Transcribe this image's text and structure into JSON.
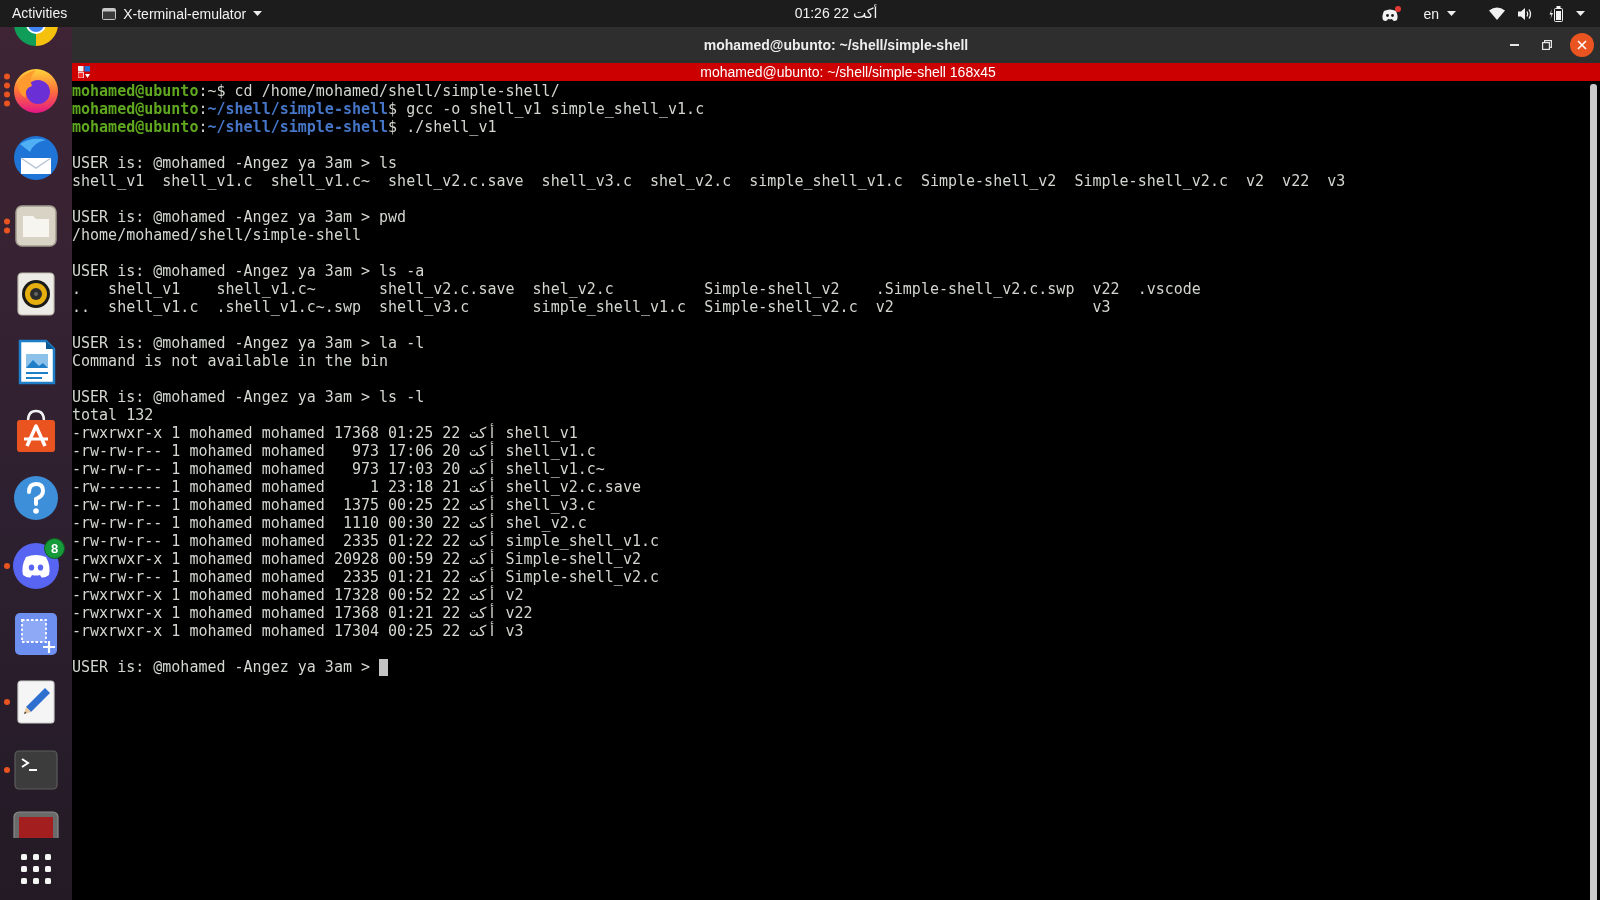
{
  "top_bar": {
    "activities": "Activities",
    "app_menu": "X-terminal-emulator",
    "clock": "01:26  22 أكت",
    "keyboard_layout": "en"
  },
  "dock": {
    "items": [
      {
        "kind": "wheel"
      },
      {
        "kind": "fox",
        "indicators": [
          {
            "kind": "dot"
          },
          {
            "kind": "dot"
          },
          {
            "kind": "dot"
          },
          {
            "kind": "dot"
          }
        ]
      },
      {
        "kind": "mail"
      },
      {
        "kind": "folder",
        "indicators": [
          {
            "kind": "dot"
          },
          {
            "kind": "dot"
          }
        ]
      },
      {
        "kind": "speaker"
      },
      {
        "kind": "document"
      },
      {
        "kind": "store"
      },
      {
        "kind": "help"
      },
      {
        "kind": "chat",
        "indicators": [
          {
            "kind": "dot"
          }
        ],
        "badge": "8"
      },
      {
        "kind": "selection"
      },
      {
        "kind": "pencil",
        "indicators": [
          {
            "kind": "dot"
          }
        ]
      },
      {
        "kind": "terminal",
        "indicators": [
          {
            "kind": "dot"
          }
        ]
      },
      {
        "kind": "tile"
      }
    ]
  },
  "window": {
    "title": "mohamed@ubunto: ~/shell/simple-shell"
  },
  "terminal_title_bar": {
    "title": "mohamed@ubunto: ~/shell/simple-shell 168x45"
  },
  "terminal": {
    "cursor": true,
    "blocks": [
      {
        "lines": [
          {
            "kind": "bash",
            "user": "mohamed@ubunto",
            "command": ":~$ cd /home/mohamed/shell/simple-shell/"
          },
          {
            "kind": "bash",
            "user": "mohamed@ubunto",
            "separator": ":",
            "path": "~/shell/simple-shell",
            "command": "$ gcc -o shell_v1 simple_shell_v1.c"
          },
          {
            "kind": "bash",
            "user": "mohamed@ubunto",
            "separator": ":",
            "path": "~/shell/simple-shell",
            "command": "$ ./shell_v1"
          }
        ]
      },
      {
        "lines": [
          {
            "kind": "prompt",
            "text": "USER is: @mohamed -Angez ya 3am > ls"
          },
          {
            "kind": "output",
            "text": "shell_v1  shell_v1.c  shell_v1.c~  shell_v2.c.save  shell_v3.c  shel_v2.c  simple_shell_v1.c  Simple-shell_v2  Simple-shell_v2.c  v2  v22  v3"
          }
        ]
      },
      {
        "lines": [
          {
            "kind": "prompt",
            "text": "USER is: @mohamed -Angez ya 3am > pwd"
          },
          {
            "kind": "output",
            "text": "/home/mohamed/shell/simple-shell"
          }
        ]
      },
      {
        "lines": [
          {
            "kind": "prompt",
            "text": "USER is: @mohamed -Angez ya 3am > ls -a"
          },
          {
            "kind": "output",
            "text": ".   shell_v1    shell_v1.c~       shell_v2.c.save  shel_v2.c          Simple-shell_v2    .Simple-shell_v2.c.swp  v22  .vscode"
          },
          {
            "kind": "output",
            "text": "..  shell_v1.c  .shell_v1.c~.swp  shell_v3.c       simple_shell_v1.c  Simple-shell_v2.c  v2                      v3"
          }
        ]
      },
      {
        "lines": [
          {
            "kind": "prompt",
            "text": "USER is: @mohamed -Angez ya 3am > la -l"
          },
          {
            "kind": "output",
            "text": "Command is not available in the bin"
          }
        ]
      },
      {
        "lines": [
          {
            "kind": "prompt",
            "text": "USER is: @mohamed -Angez ya 3am > ls -l"
          },
          {
            "kind": "output",
            "text": "total 132"
          },
          {
            "kind": "output",
            "text": "-rwxrwxr-x 1 mohamed mohamed 17368 01:25 22 أكت shell_v1"
          },
          {
            "kind": "output",
            "text": "-rw-rw-r-- 1 mohamed mohamed   973 17:06 20 أكت shell_v1.c"
          },
          {
            "kind": "output",
            "text": "-rw-rw-r-- 1 mohamed mohamed   973 17:03 20 أكت shell_v1.c~"
          },
          {
            "kind": "output",
            "text": "-rw------- 1 mohamed mohamed     1 23:18 21 أكت shell_v2.c.save"
          },
          {
            "kind": "output",
            "text": "-rw-rw-r-- 1 mohamed mohamed  1375 00:25 22 أكت shell_v3.c"
          },
          {
            "kind": "output",
            "text": "-rw-rw-r-- 1 mohamed mohamed  1110 00:30 22 أكت shel_v2.c"
          },
          {
            "kind": "output",
            "text": "-rw-rw-r-- 1 mohamed mohamed  2335 01:22 22 أكت simple_shell_v1.c"
          },
          {
            "kind": "output",
            "text": "-rwxrwxr-x 1 mohamed mohamed 20928 00:59 22 أكت Simple-shell_v2"
          },
          {
            "kind": "output",
            "text": "-rw-rw-r-- 1 mohamed mohamed  2335 01:21 22 أكت Simple-shell_v2.c"
          },
          {
            "kind": "output",
            "text": "-rwxrwxr-x 1 mohamed mohamed 17328 00:52 22 أكت v2"
          },
          {
            "kind": "output",
            "text": "-rwxrwxr-x 1 mohamed mohamed 17368 01:21 22 أكت v22"
          },
          {
            "kind": "output",
            "text": "-rwxrwxr-x 1 mohamed mohamed 17304 00:25 22 أكت v3"
          }
        ]
      },
      {
        "lines": [
          {
            "kind": "prompt",
            "text": "USER is: @mohamed -Angez ya 3am > "
          }
        ]
      }
    ]
  }
}
